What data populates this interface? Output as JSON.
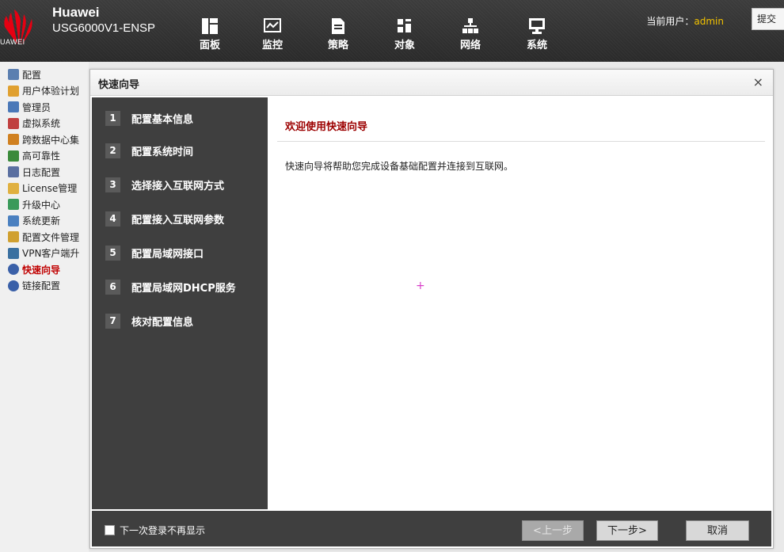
{
  "header": {
    "logo_text": "UAWEI",
    "brand_name": "Huawei",
    "model": "USG6000V1-ENSP",
    "nav": [
      {
        "label": "面板",
        "icon": "panel-icon"
      },
      {
        "label": "监控",
        "icon": "monitor-icon"
      },
      {
        "label": "策略",
        "icon": "policy-icon"
      },
      {
        "label": "对象",
        "icon": "object-icon"
      },
      {
        "label": "网络",
        "icon": "network-icon"
      },
      {
        "label": "系统",
        "icon": "system-icon"
      }
    ],
    "user_label": "当前用户：",
    "user_name": "admin",
    "submit_label": "提交"
  },
  "sidebar": {
    "items": [
      {
        "label": "配置",
        "color": "#5b7fb0"
      },
      {
        "label": "用户体验计划",
        "color": "#e0a030"
      },
      {
        "label": "管理员",
        "color": "#4a78b8"
      },
      {
        "label": "虚拟系统",
        "color": "#c04040"
      },
      {
        "label": "跨数据中心集",
        "color": "#d08020"
      },
      {
        "label": "高可靠性",
        "color": "#3a8a3a"
      },
      {
        "label": "日志配置",
        "color": "#5a6fa0"
      },
      {
        "label": "License管理",
        "color": "#e0b040"
      },
      {
        "label": "升级中心",
        "color": "#3a9a5a"
      },
      {
        "label": "系统更新",
        "color": "#4a80c0"
      },
      {
        "label": "配置文件管理",
        "color": "#d0a030"
      },
      {
        "label": "VPN客户端升",
        "color": "#3a70a0"
      },
      {
        "label": "快速向导",
        "color": "#3a60a8"
      },
      {
        "label": "链接配置",
        "color": "#3a60a8"
      }
    ],
    "active_index": 12
  },
  "dialog": {
    "title": "快速向导",
    "close": "×",
    "steps": [
      {
        "num": "1",
        "label": "配置基本信息"
      },
      {
        "num": "2",
        "label": "配置系统时间"
      },
      {
        "num": "3",
        "label": "选择接入互联网方式"
      },
      {
        "num": "4",
        "label": "配置接入互联网参数"
      },
      {
        "num": "5",
        "label": "配置局域网接口"
      },
      {
        "num": "6",
        "label": "配置局域网DHCP服务"
      },
      {
        "num": "7",
        "label": "核对配置信息"
      }
    ],
    "content_title": "欢迎使用快速向导",
    "content_desc": "快速向导将帮助您完成设备基础配置并连接到互联网。",
    "cursor_glyph": "+",
    "footer": {
      "checkbox_label": "下一次登录不再显示",
      "prev_label": "<上一步",
      "next_label": "下一步>",
      "cancel_label": "取消"
    }
  }
}
